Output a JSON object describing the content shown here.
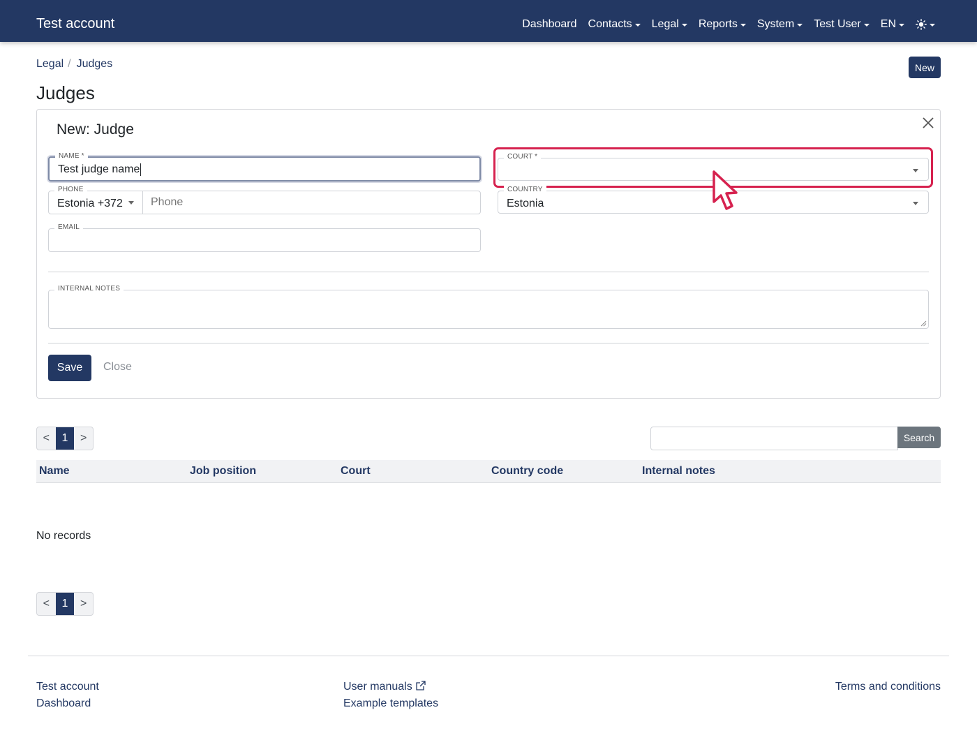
{
  "navbar": {
    "brand": "Test account",
    "items": [
      {
        "label": "Dashboard",
        "dropdown": false
      },
      {
        "label": "Contacts",
        "dropdown": true
      },
      {
        "label": "Legal",
        "dropdown": true
      },
      {
        "label": "Reports",
        "dropdown": true
      },
      {
        "label": "System",
        "dropdown": true
      },
      {
        "label": "Test User",
        "dropdown": true
      },
      {
        "label": "EN",
        "dropdown": true
      }
    ],
    "theme_icon": "sun-icon"
  },
  "breadcrumb": {
    "items": [
      "Legal",
      "Judges"
    ],
    "separator": "/"
  },
  "page": {
    "title": "Judges",
    "new_button": "New"
  },
  "form": {
    "title": "New: Judge",
    "name": {
      "label": "NAME *",
      "value": "Test judge name"
    },
    "court": {
      "label": "COURT *",
      "value": ""
    },
    "phone": {
      "label": "PHONE",
      "country_code": "Estonia +372",
      "placeholder": "Phone"
    },
    "country": {
      "label": "COUNTRY",
      "value": "Estonia"
    },
    "email": {
      "label": "EMAIL",
      "value": ""
    },
    "internal_notes": {
      "label": "INTERNAL NOTES",
      "value": ""
    },
    "save_label": "Save",
    "close_label": "Close"
  },
  "pagination": {
    "prev": "<",
    "current": "1",
    "next": ">"
  },
  "search": {
    "button": "Search",
    "value": ""
  },
  "table": {
    "columns": [
      "Name",
      "Job position",
      "Court",
      "Country code",
      "Internal notes"
    ],
    "empty_text": "No records"
  },
  "footer": {
    "col1": [
      "Test account",
      "Dashboard"
    ],
    "col2": [
      "User manuals",
      "Example templates"
    ],
    "col3": [
      "Terms and conditions"
    ]
  },
  "colors": {
    "primary": "#233863",
    "highlight": "#d6224f",
    "secondary": "#6c757d"
  }
}
